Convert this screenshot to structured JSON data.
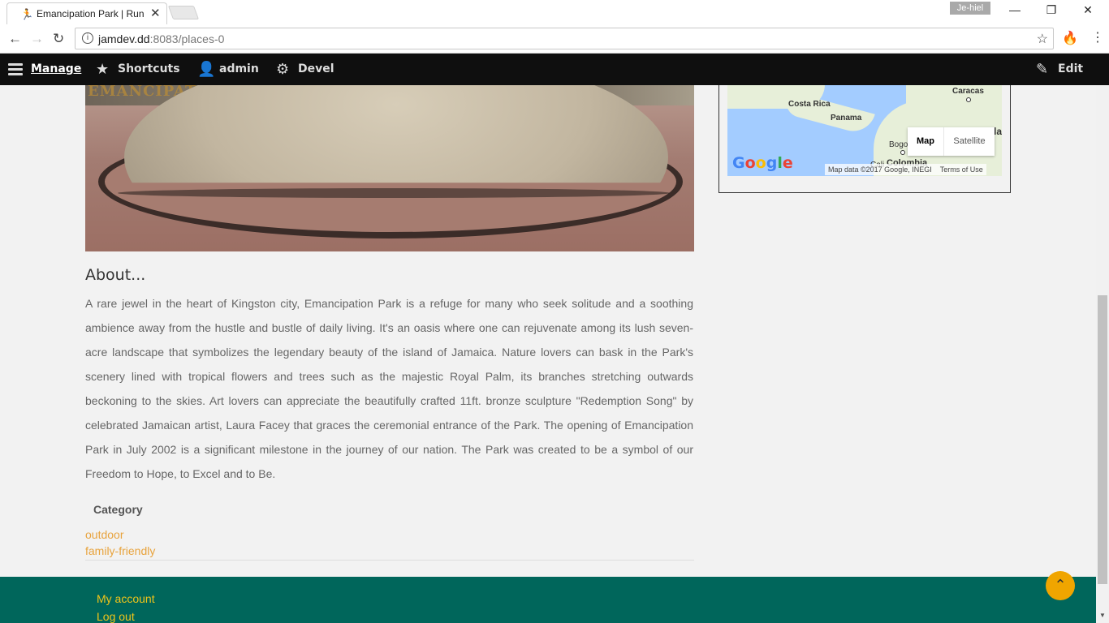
{
  "browser": {
    "tab_title": "Emancipation Park | Run",
    "tab_favicon": "🏃",
    "profile_name": "Je-hiel",
    "url_host": "jamdev.dd",
    "url_rest": ":8083/places-0"
  },
  "admin_toolbar": {
    "manage": "Manage",
    "shortcuts": "Shortcuts",
    "admin": "admin",
    "devel": "Devel",
    "edit": "Edit"
  },
  "hero": {
    "sign_text": "EMANCIPATION PARK"
  },
  "about": {
    "title": "About...",
    "text": " A rare jewel in the heart of Kingston city, Emancipation Park is a refuge for many who seek solitude and a soothing ambience away from the hustle and bustle of daily living. It's an oasis where one can rejuvenate among its lush seven-acre landscape that symbolizes the legendary beauty of the island of Jamaica. Nature lovers can bask in the Park's scenery lined with tropical flowers and trees such as the majestic Royal Palm, its branches stretching outwards beckoning to the skies. Art lovers can appreciate the beautifully crafted 11ft. bronze sculpture \"Redemption Song\" by celebrated Jamaican artist, Laura Facey that graces the ceremonial entrance of the Park. The opening of Emancipation Park in July 2002 is a significant milestone in the journey of our nation. The Park was created to be a symbol of our Freedom to Hope, to Excel and to Be."
  },
  "category": {
    "label": "Category",
    "items": [
      "outdoor",
      "family-friendly"
    ]
  },
  "map": {
    "labels": [
      "Caracas",
      "Costa Rica",
      "Panama",
      "Bogo",
      "Colombia",
      "la",
      "Cali"
    ],
    "map_button": "Map",
    "satellite_button": "Satellite",
    "logo": "Google",
    "attribution": "Map data ©2017 Google, INEGI",
    "terms": "Terms of Use"
  },
  "footer": {
    "links": [
      "My account",
      "Log out"
    ]
  },
  "colors": {
    "accent": "#e8a33d",
    "footer_bg": "#00665b",
    "footer_link": "#f0c419"
  }
}
